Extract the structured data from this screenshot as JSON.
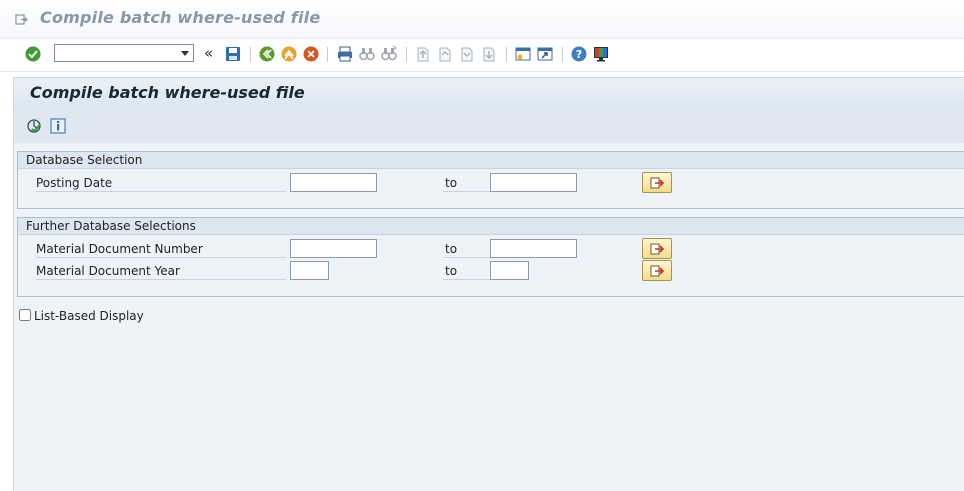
{
  "window": {
    "title": "Compile batch where-used file"
  },
  "toolbar": {
    "command_value": "",
    "icons": [
      "enter-icon",
      "command-field",
      "collapse-icon",
      "save-icon",
      "back-icon",
      "exit-icon",
      "cancel-icon",
      "print-icon",
      "find-icon",
      "find-next-icon",
      "first-page-icon",
      "previous-page-icon",
      "next-page-icon",
      "last-page-icon",
      "create-session-icon",
      "shortcut-icon",
      "help-icon",
      "customize-icon"
    ]
  },
  "screen": {
    "title": "Compile batch where-used file",
    "app_buttons": [
      "execute-icon",
      "info-icon"
    ]
  },
  "groups": {
    "database_selection": {
      "title": "Database Selection",
      "rows": [
        {
          "label": "Posting Date",
          "from": "",
          "to_label": "to",
          "to": ""
        }
      ]
    },
    "further_selections": {
      "title": "Further Database Selections",
      "rows": [
        {
          "label": "Material Document Number",
          "from": "",
          "to_label": "to",
          "to": ""
        },
        {
          "label": "Material Document Year",
          "from": "",
          "to_label": "to",
          "to": ""
        }
      ]
    }
  },
  "options": {
    "list_based_display": {
      "label": "List-Based Display",
      "checked": false
    }
  },
  "colors": {
    "title_grey": "#8a97a8",
    "panel_bg": "#eef3f8",
    "header_bg": "#dbe6f1",
    "multi_btn": "#f3dd8a"
  }
}
